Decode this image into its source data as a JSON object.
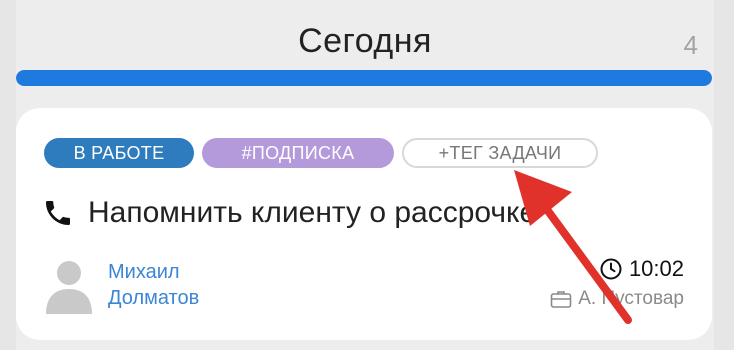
{
  "column": {
    "title": "Сегодня",
    "count": "4",
    "progress": 1.0
  },
  "card": {
    "tags": {
      "status": "В РАБОТЕ",
      "topic": "#ПОДПИСКА",
      "add": "+ТЕГ ЗАДАЧИ"
    },
    "task_icon": "phone-icon",
    "task_title": "Напомнить клиенту о рассрочке",
    "assignee": {
      "first_name": "Михаил",
      "last_name": "Долматов"
    },
    "time": "10:02",
    "owner": "А. Пустовар"
  },
  "colors": {
    "progress": "#1f7ae0",
    "status_tag": "#2e7bbd",
    "topic_tag": "#b49adb",
    "assignee_link": "#3c86d4",
    "annotation_arrow": "#e0322b"
  }
}
